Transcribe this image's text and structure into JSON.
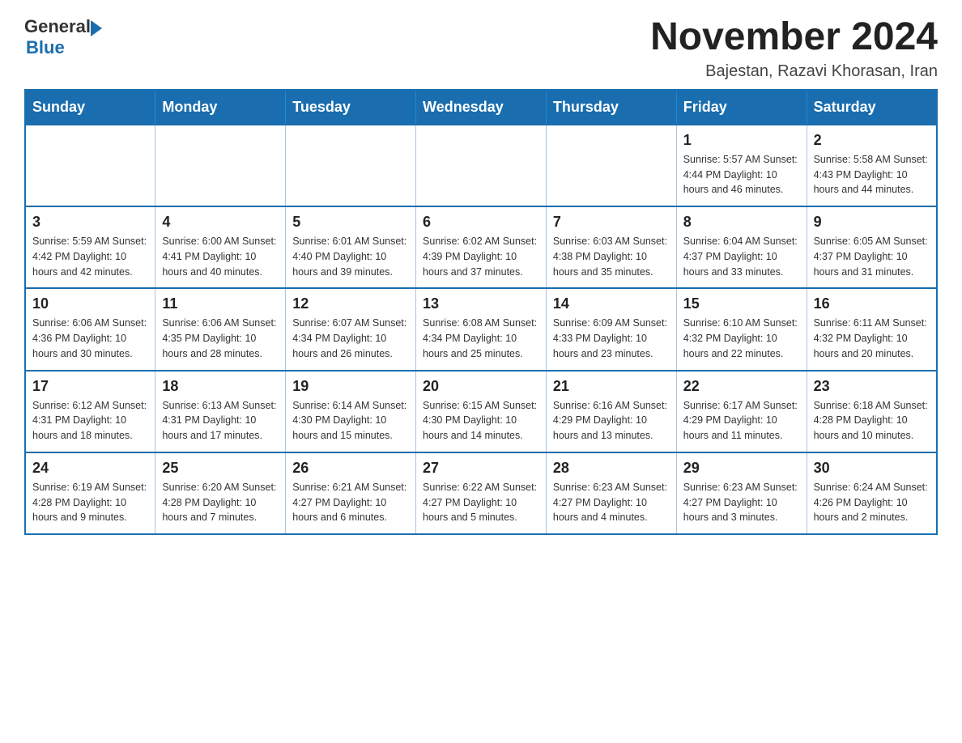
{
  "header": {
    "logo_general": "General",
    "logo_blue": "Blue",
    "month_year": "November 2024",
    "location": "Bajestan, Razavi Khorasan, Iran"
  },
  "days_of_week": [
    "Sunday",
    "Monday",
    "Tuesday",
    "Wednesday",
    "Thursday",
    "Friday",
    "Saturday"
  ],
  "weeks": [
    [
      {
        "day": "",
        "info": ""
      },
      {
        "day": "",
        "info": ""
      },
      {
        "day": "",
        "info": ""
      },
      {
        "day": "",
        "info": ""
      },
      {
        "day": "",
        "info": ""
      },
      {
        "day": "1",
        "info": "Sunrise: 5:57 AM\nSunset: 4:44 PM\nDaylight: 10 hours and 46 minutes."
      },
      {
        "day": "2",
        "info": "Sunrise: 5:58 AM\nSunset: 4:43 PM\nDaylight: 10 hours and 44 minutes."
      }
    ],
    [
      {
        "day": "3",
        "info": "Sunrise: 5:59 AM\nSunset: 4:42 PM\nDaylight: 10 hours and 42 minutes."
      },
      {
        "day": "4",
        "info": "Sunrise: 6:00 AM\nSunset: 4:41 PM\nDaylight: 10 hours and 40 minutes."
      },
      {
        "day": "5",
        "info": "Sunrise: 6:01 AM\nSunset: 4:40 PM\nDaylight: 10 hours and 39 minutes."
      },
      {
        "day": "6",
        "info": "Sunrise: 6:02 AM\nSunset: 4:39 PM\nDaylight: 10 hours and 37 minutes."
      },
      {
        "day": "7",
        "info": "Sunrise: 6:03 AM\nSunset: 4:38 PM\nDaylight: 10 hours and 35 minutes."
      },
      {
        "day": "8",
        "info": "Sunrise: 6:04 AM\nSunset: 4:37 PM\nDaylight: 10 hours and 33 minutes."
      },
      {
        "day": "9",
        "info": "Sunrise: 6:05 AM\nSunset: 4:37 PM\nDaylight: 10 hours and 31 minutes."
      }
    ],
    [
      {
        "day": "10",
        "info": "Sunrise: 6:06 AM\nSunset: 4:36 PM\nDaylight: 10 hours and 30 minutes."
      },
      {
        "day": "11",
        "info": "Sunrise: 6:06 AM\nSunset: 4:35 PM\nDaylight: 10 hours and 28 minutes."
      },
      {
        "day": "12",
        "info": "Sunrise: 6:07 AM\nSunset: 4:34 PM\nDaylight: 10 hours and 26 minutes."
      },
      {
        "day": "13",
        "info": "Sunrise: 6:08 AM\nSunset: 4:34 PM\nDaylight: 10 hours and 25 minutes."
      },
      {
        "day": "14",
        "info": "Sunrise: 6:09 AM\nSunset: 4:33 PM\nDaylight: 10 hours and 23 minutes."
      },
      {
        "day": "15",
        "info": "Sunrise: 6:10 AM\nSunset: 4:32 PM\nDaylight: 10 hours and 22 minutes."
      },
      {
        "day": "16",
        "info": "Sunrise: 6:11 AM\nSunset: 4:32 PM\nDaylight: 10 hours and 20 minutes."
      }
    ],
    [
      {
        "day": "17",
        "info": "Sunrise: 6:12 AM\nSunset: 4:31 PM\nDaylight: 10 hours and 18 minutes."
      },
      {
        "day": "18",
        "info": "Sunrise: 6:13 AM\nSunset: 4:31 PM\nDaylight: 10 hours and 17 minutes."
      },
      {
        "day": "19",
        "info": "Sunrise: 6:14 AM\nSunset: 4:30 PM\nDaylight: 10 hours and 15 minutes."
      },
      {
        "day": "20",
        "info": "Sunrise: 6:15 AM\nSunset: 4:30 PM\nDaylight: 10 hours and 14 minutes."
      },
      {
        "day": "21",
        "info": "Sunrise: 6:16 AM\nSunset: 4:29 PM\nDaylight: 10 hours and 13 minutes."
      },
      {
        "day": "22",
        "info": "Sunrise: 6:17 AM\nSunset: 4:29 PM\nDaylight: 10 hours and 11 minutes."
      },
      {
        "day": "23",
        "info": "Sunrise: 6:18 AM\nSunset: 4:28 PM\nDaylight: 10 hours and 10 minutes."
      }
    ],
    [
      {
        "day": "24",
        "info": "Sunrise: 6:19 AM\nSunset: 4:28 PM\nDaylight: 10 hours and 9 minutes."
      },
      {
        "day": "25",
        "info": "Sunrise: 6:20 AM\nSunset: 4:28 PM\nDaylight: 10 hours and 7 minutes."
      },
      {
        "day": "26",
        "info": "Sunrise: 6:21 AM\nSunset: 4:27 PM\nDaylight: 10 hours and 6 minutes."
      },
      {
        "day": "27",
        "info": "Sunrise: 6:22 AM\nSunset: 4:27 PM\nDaylight: 10 hours and 5 minutes."
      },
      {
        "day": "28",
        "info": "Sunrise: 6:23 AM\nSunset: 4:27 PM\nDaylight: 10 hours and 4 minutes."
      },
      {
        "day": "29",
        "info": "Sunrise: 6:23 AM\nSunset: 4:27 PM\nDaylight: 10 hours and 3 minutes."
      },
      {
        "day": "30",
        "info": "Sunrise: 6:24 AM\nSunset: 4:26 PM\nDaylight: 10 hours and 2 minutes."
      }
    ]
  ]
}
